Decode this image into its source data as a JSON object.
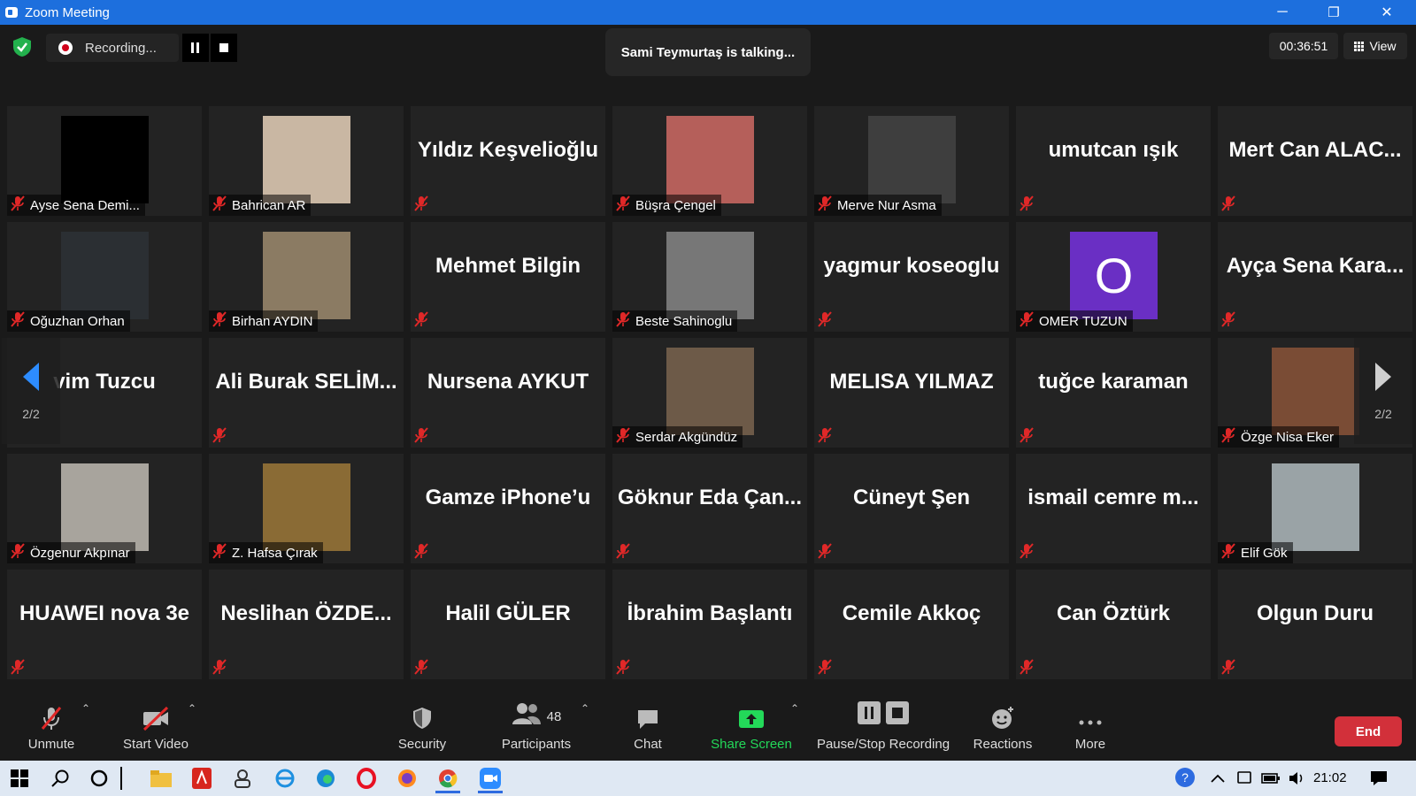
{
  "window": {
    "title": "Zoom Meeting",
    "minimize": "─",
    "restore": "❐",
    "close": "✕"
  },
  "recording": {
    "label": "Recording..."
  },
  "talking": "Sami Teymurtaş is talking...",
  "timer": "00:36:51",
  "view_label": "View",
  "page_indicator": "2/2",
  "participants": [
    {
      "name": "Ayse Sena Demi...",
      "mode": "photo",
      "color": "#000000"
    },
    {
      "name": "Bahrican AR",
      "mode": "photo",
      "color": "#c9b7a3"
    },
    {
      "name": "Yıldız Keşvelioğlu",
      "mode": "name"
    },
    {
      "name": "Büşra Çengel",
      "mode": "photo",
      "color": "#b55f5a"
    },
    {
      "name": "Merve Nur Asma",
      "mode": "photo",
      "color": "#3e3e3e"
    },
    {
      "name": "umutcan ışık",
      "mode": "name"
    },
    {
      "name": "Mert Can ALAC...",
      "mode": "name"
    },
    {
      "name": "Oğuzhan Orhan",
      "mode": "photo",
      "color": "#2b2f33"
    },
    {
      "name": "Birhan AYDIN",
      "mode": "photo",
      "color": "#8b7b63"
    },
    {
      "name": "Mehmet Bilgin",
      "mode": "name"
    },
    {
      "name": "Beste Sahinoglu",
      "mode": "photo",
      "color": "#777777"
    },
    {
      "name": "yagmur koseoglu",
      "mode": "name"
    },
    {
      "name": "OMER TUZUN",
      "mode": "letter",
      "letter": "O"
    },
    {
      "name": "Ayça Sena Kara...",
      "mode": "name"
    },
    {
      "name": "vim Tuzcu",
      "mode": "name",
      "nolabel": true
    },
    {
      "name": "Ali Burak SELİM...",
      "mode": "name"
    },
    {
      "name": "Nursena AYKUT",
      "mode": "name"
    },
    {
      "name": "Serdar Akgündüz",
      "mode": "photo",
      "color": "#6d5a48"
    },
    {
      "name": "MELISA YILMAZ",
      "mode": "name"
    },
    {
      "name": "tuğce karaman",
      "mode": "name"
    },
    {
      "name": "Özge Nisa Eker",
      "mode": "photo",
      "color": "#7a4c35"
    },
    {
      "name": "Özgenur Akpınar",
      "mode": "photo",
      "color": "#a8a49d"
    },
    {
      "name": "Z. Hafsa Çırak",
      "mode": "photo",
      "color": "#8a6b35"
    },
    {
      "name": "Gamze iPhone’u",
      "mode": "name"
    },
    {
      "name": "Göknur Eda Çan...",
      "mode": "name"
    },
    {
      "name": "Cüneyt Şen",
      "mode": "name"
    },
    {
      "name": "ismail cemre m...",
      "mode": "name"
    },
    {
      "name": "Elif Gök",
      "mode": "photo",
      "color": "#9aa3a6"
    },
    {
      "name": "HUAWEI nova 3e",
      "mode": "name"
    },
    {
      "name": "Neslihan ÖZDE...",
      "mode": "name"
    },
    {
      "name": "Halil GÜLER",
      "mode": "name"
    },
    {
      "name": "İbrahim Başlantı",
      "mode": "name"
    },
    {
      "name": "Cemile Akkoç",
      "mode": "name"
    },
    {
      "name": "Can Öztürk",
      "mode": "name"
    },
    {
      "name": "Olgun Duru",
      "mode": "name"
    }
  ],
  "toolbar": {
    "unmute": "Unmute",
    "start_video": "Start Video",
    "security": "Security",
    "participants": "Participants",
    "participant_count": "48",
    "chat": "Chat",
    "share_screen": "Share Screen",
    "pause_stop": "Pause/Stop Recording",
    "reactions": "Reactions",
    "more": "More",
    "end": "End"
  },
  "taskbar": {
    "time": "21:02"
  },
  "colors": {
    "accent_blue": "#1d6fdd",
    "share_green": "#23d959",
    "end_red": "#d2303a",
    "mute_red": "#e02828"
  }
}
